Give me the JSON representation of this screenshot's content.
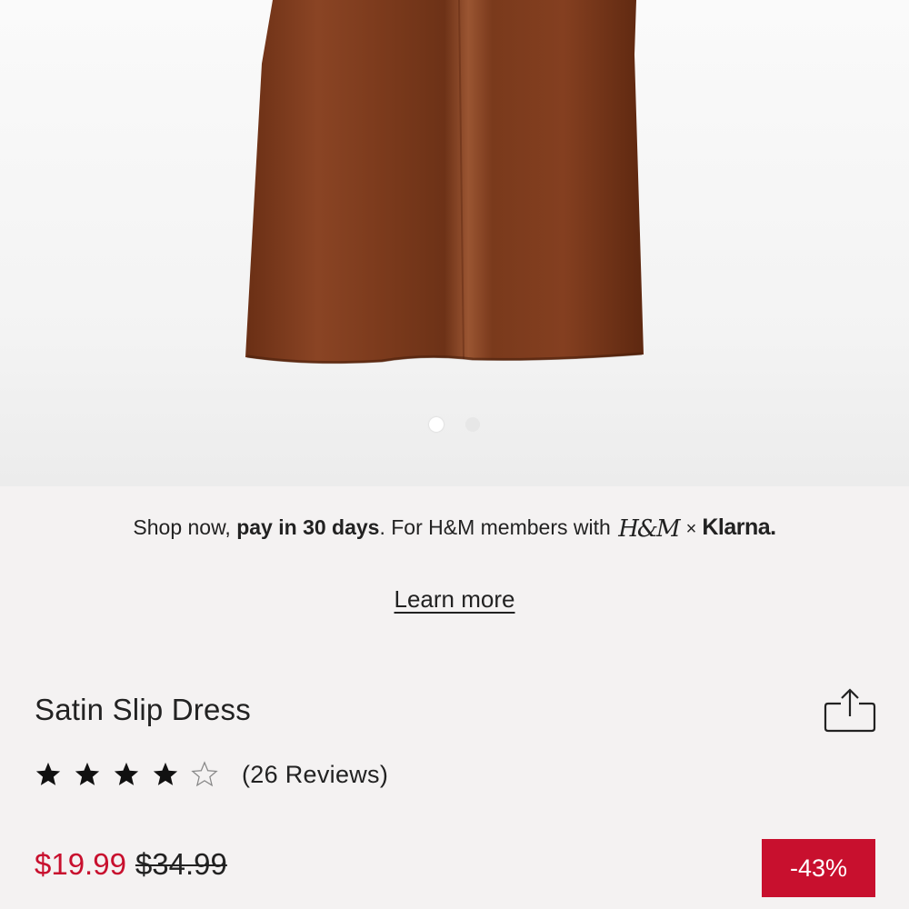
{
  "hero": {
    "image_description": "brown satin slip dress",
    "dress_color": "#7a3a1c",
    "carousel": {
      "total": 2,
      "active_index": 0
    }
  },
  "promo": {
    "text_before": "Shop now, ",
    "text_bold": "pay in 30 days",
    "text_after": ". For H&M members with ",
    "hm_logo": "H&M",
    "times": "×",
    "klarna": "Klarna."
  },
  "learn_more": "Learn more",
  "product": {
    "title": "Satin Slip Dress",
    "rating": 4,
    "rating_max": 5,
    "reviews": "(26 Reviews)",
    "price_sale": "$19.99",
    "price_original": "$34.99",
    "discount": "-43%"
  },
  "colors": {
    "sale": "#c8102e",
    "text": "#222222",
    "background": "#f4f2f2"
  },
  "icons": {
    "share": "share-icon",
    "star_filled": "star-filled-icon",
    "star_empty": "star-outline-icon"
  }
}
